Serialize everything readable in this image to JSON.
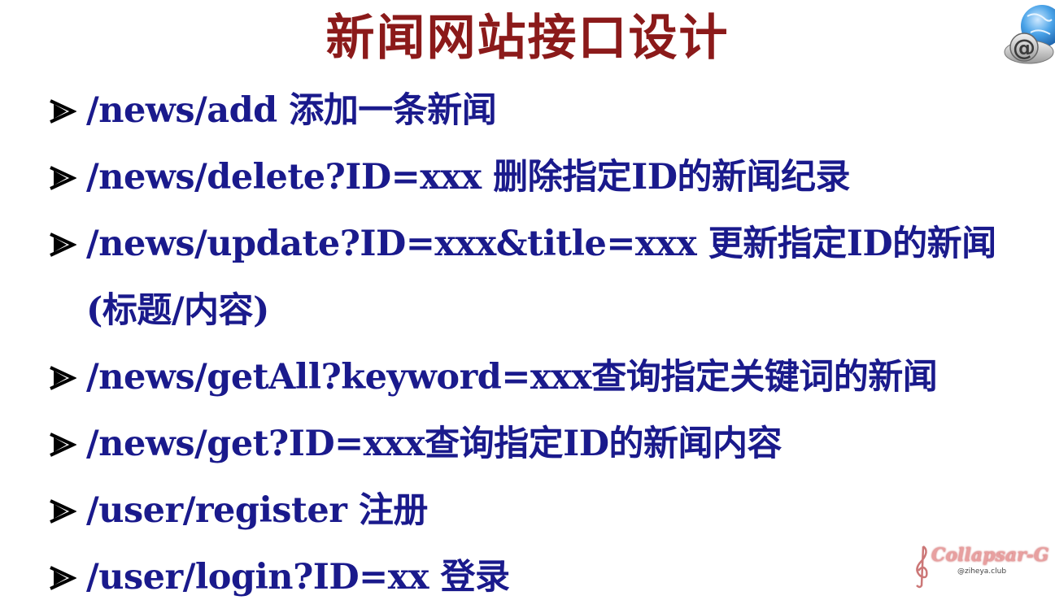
{
  "slide": {
    "title": "新闻网站接口设计",
    "bullets": [
      {
        "text": "/news/add 添加一条新闻"
      },
      {
        "text": "/news/delete?ID=xxx 删除指定ID的新闻纪录"
      },
      {
        "text": "/news/update?ID=xxx&title=xxx 更新指定ID的新闻(标题/内容)"
      },
      {
        "text": "/news/getAll?keyword=xxx查询指定关键词的新闻"
      },
      {
        "text": "/news/get?ID=xxx查询指定ID的新闻内容"
      },
      {
        "text": "/user/register 注册"
      },
      {
        "text": "/user/login?ID=xx 登录"
      }
    ],
    "logo_icon": "email-globe-icon",
    "watermark": {
      "text": "Collapsar-G",
      "sub": "@ziheya.club"
    },
    "colors": {
      "title": "#8b1a1a",
      "bullet_text": "#1a1a8c",
      "background": "#ffffff"
    }
  }
}
